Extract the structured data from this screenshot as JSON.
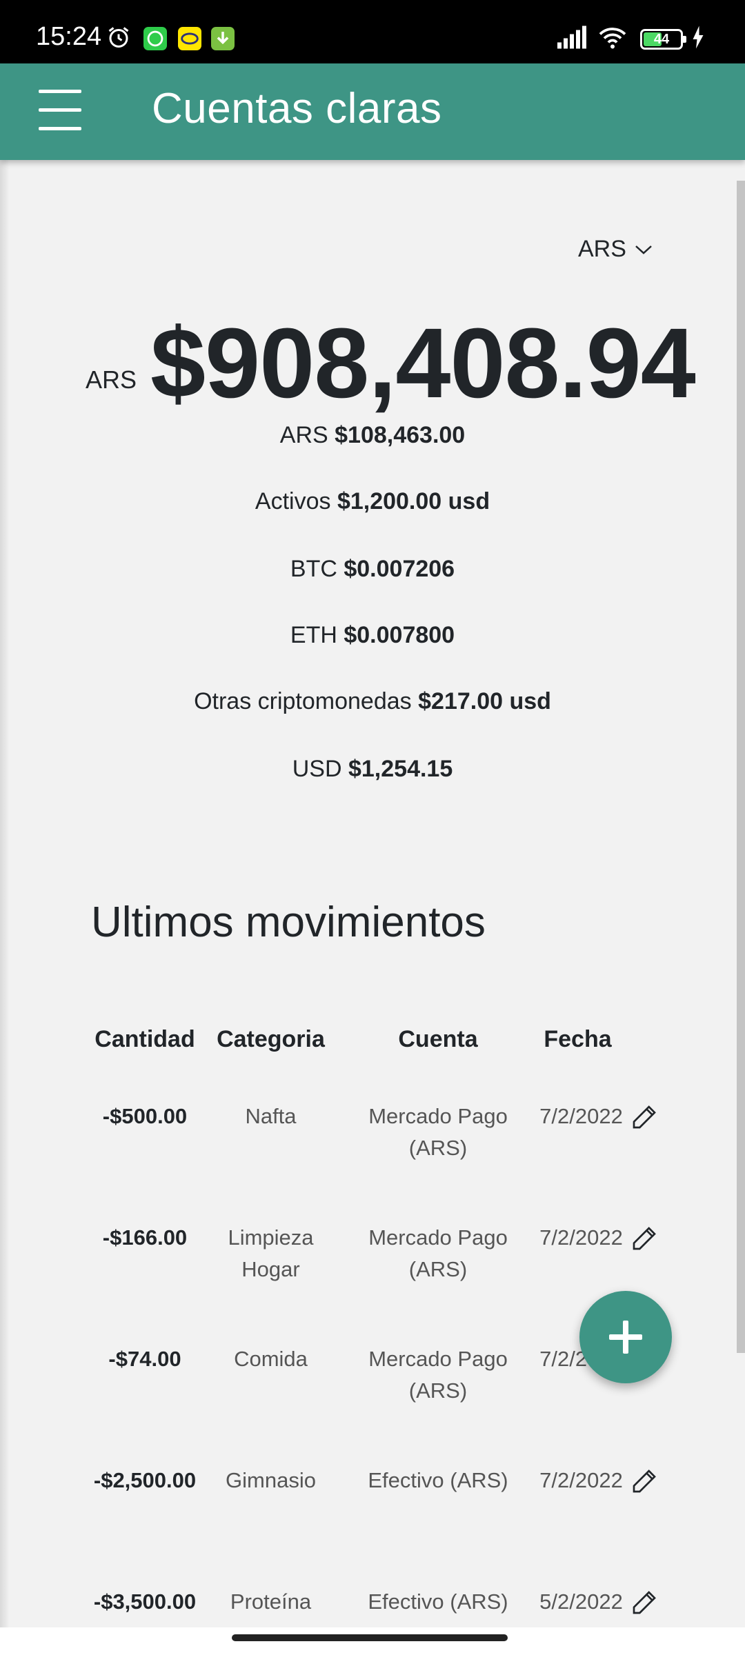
{
  "status_bar": {
    "time": "15:24",
    "battery": "44",
    "icons": [
      "alarm-icon",
      "whatsapp-icon",
      "mercadolibre-icon",
      "download-icon",
      "signal-icon",
      "wifi-icon",
      "battery-icon",
      "charging-icon"
    ]
  },
  "app_bar": {
    "title": "Cuentas claras",
    "menu_icon": "hamburger-menu-icon"
  },
  "currency_selector": {
    "selected": "ARS",
    "icon": "chevron-down-icon"
  },
  "total": {
    "currency": "ARS",
    "amount": "$908,408.94"
  },
  "balances": [
    {
      "label": "ARS",
      "value": "$108,463.00"
    },
    {
      "label": "Activos",
      "value": "$1,200.00 usd"
    },
    {
      "label": "BTC",
      "value": "$0.007206"
    },
    {
      "label": "ETH",
      "value": "$0.007800"
    },
    {
      "label": "Otras criptomonedas",
      "value": "$217.00 usd"
    },
    {
      "label": "USD",
      "value": "$1,254.15"
    }
  ],
  "movements": {
    "title": "Ultimos movimientos",
    "headers": [
      "Cantidad",
      "Categoria",
      "Cuenta",
      "Fecha"
    ],
    "rows": [
      {
        "amount": "-$500.00",
        "category_lines": [
          "Nafta"
        ],
        "account_lines": [
          "Mercado Pago",
          "(ARS)"
        ],
        "date": "7/2/2022"
      },
      {
        "amount": "-$166.00",
        "category_lines": [
          "Limpieza",
          "Hogar"
        ],
        "account_lines": [
          "Mercado Pago",
          "(ARS)"
        ],
        "date": "7/2/2022"
      },
      {
        "amount": "-$74.00",
        "category_lines": [
          "Comida"
        ],
        "account_lines": [
          "Mercado Pago",
          "(ARS)"
        ],
        "date": "7/2/2022"
      },
      {
        "amount": "-$2,500.00",
        "category_lines": [
          "Gimnasio"
        ],
        "account_lines": [
          "Efectivo (ARS)"
        ],
        "date": "7/2/2022"
      },
      {
        "amount": "-$3,500.00",
        "category_lines": [
          "Proteína"
        ],
        "account_lines": [
          "Efectivo (ARS)"
        ],
        "date": "5/2/2022"
      }
    ],
    "edit_icon": "pencil-icon"
  },
  "fab": {
    "icon": "plus-icon",
    "color": "#3e9585"
  },
  "colors": {
    "primary": "#3e9585",
    "background": "#f2f2f2",
    "text": "#212529"
  }
}
